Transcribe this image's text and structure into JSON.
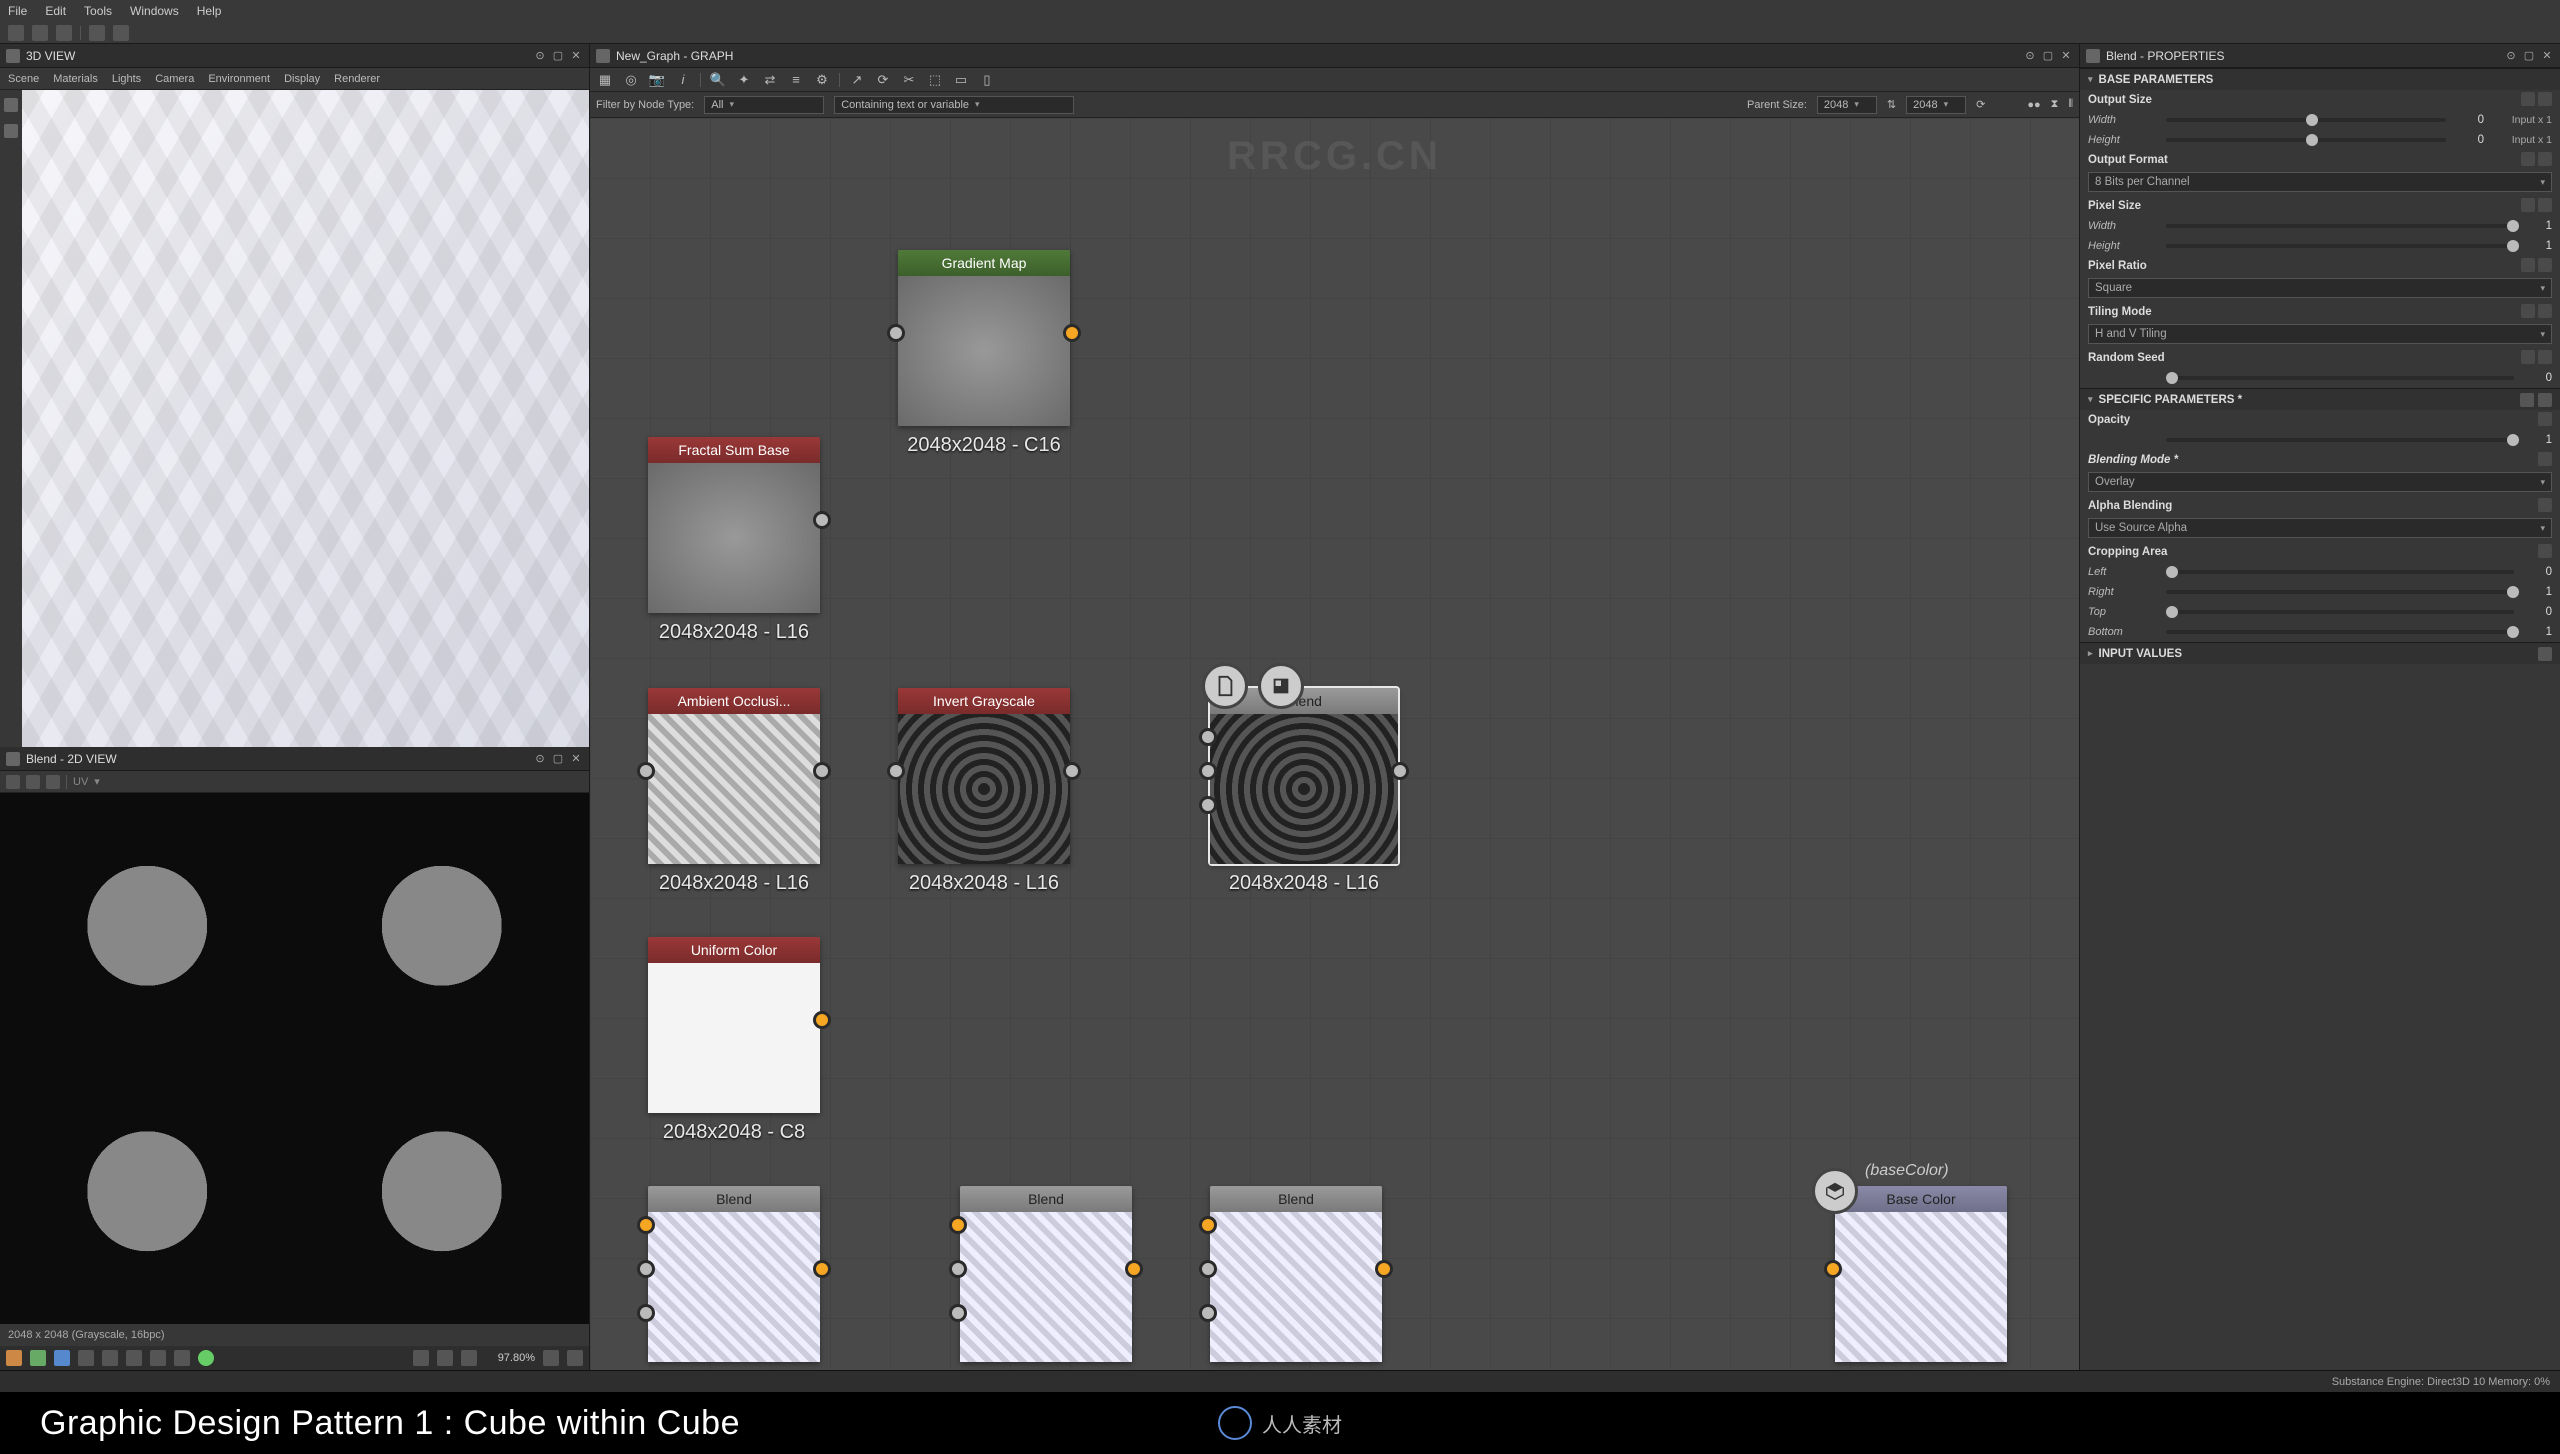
{
  "menubar": [
    "File",
    "Edit",
    "Tools",
    "Windows",
    "Help"
  ],
  "watermark": "RRCG.CN",
  "panels": {
    "view3d": {
      "title": "3D VIEW",
      "subtabs": [
        "Scene",
        "Materials",
        "Lights",
        "Camera",
        "Environment",
        "Display",
        "Renderer"
      ]
    },
    "view2d": {
      "title": "Blend - 2D VIEW",
      "uv": "UV",
      "status": "2048 x 2048 (Grayscale, 16bpc)",
      "zoom": "97.80%"
    },
    "graph": {
      "title": "New_Graph - GRAPH",
      "filter": {
        "label": "Filter by Node Type:",
        "type_value": "All",
        "contain_label": "Containing text or variable",
        "parent_label": "Parent Size:",
        "parent_val": "2048",
        "size_val": "2048"
      }
    },
    "properties": {
      "title": "Blend - PROPERTIES",
      "sections": {
        "base": "BASE PARAMETERS",
        "specific": "SPECIFIC PARAMETERS *",
        "input": "INPUT VALUES"
      },
      "output_size": {
        "label": "Output Size",
        "width_label": "Width",
        "width_val": "0",
        "width_extra": "Input x 1",
        "height_label": "Height",
        "height_val": "0",
        "height_extra": "Input x 1"
      },
      "output_format_label": "Output Format",
      "output_format_value": "8 Bits per Channel",
      "pixel_size": {
        "label": "Pixel Size",
        "width_label": "Width",
        "width_val": "1",
        "height_label": "Height",
        "height_val": "1"
      },
      "pixel_ratio_label": "Pixel Ratio",
      "pixel_ratio_value": "Square",
      "tiling_label": "Tiling Mode",
      "tiling_value": "H and V Tiling",
      "random_seed": {
        "label": "Random Seed",
        "val": "0"
      },
      "opacity": {
        "label": "Opacity",
        "val": "1"
      },
      "blending_mode": {
        "label": "Blending Mode *",
        "value": "Overlay"
      },
      "alpha_blending": {
        "label": "Alpha Blending",
        "value": "Use Source Alpha"
      },
      "cropping": {
        "label": "Cropping Area",
        "left_label": "Left",
        "left_val": "0",
        "right_label": "Right",
        "right_val": "1",
        "top_label": "Top",
        "top_val": "0",
        "bottom_label": "Bottom",
        "bottom_val": "1"
      }
    }
  },
  "nodes": {
    "gradient_map": {
      "title": "Gradient Map",
      "caption": "2048x2048 - C16"
    },
    "fractal": {
      "title": "Fractal Sum Base",
      "caption": "2048x2048 - L16"
    },
    "ao": {
      "title": "Ambient Occlusi...",
      "caption": "2048x2048 - L16"
    },
    "invert": {
      "title": "Invert Grayscale",
      "caption": "2048x2048 - L16"
    },
    "blend_sel": {
      "title": "Blend",
      "caption": "2048x2048 - L16"
    },
    "uniform": {
      "title": "Uniform Color",
      "caption": "2048x2048 - C8"
    },
    "blend1": {
      "title": "Blend"
    },
    "blend2": {
      "title": "Blend"
    },
    "blend3": {
      "title": "Blend"
    },
    "basecolor": {
      "title": "Base Color",
      "tooltip": "(baseColor)"
    }
  },
  "status_strip": "Substance Engine: Direct3D 10  Memory: 0%",
  "caption": "Graphic Design Pattern 1 : Cube within Cube",
  "footer_logo": "人人素材"
}
